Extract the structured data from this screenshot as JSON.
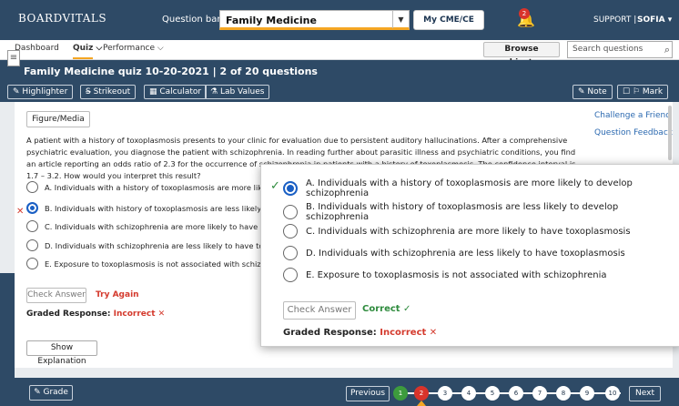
{
  "header": {
    "logo": "BOARDVITALS",
    "question_bank_label": "Question bank:",
    "question_bank_value": "Family Medicine",
    "my_cme": "My CME/CE",
    "notification_count": "2",
    "support": "SUPPORT |",
    "user": "SOFIA ▾"
  },
  "nav": {
    "dashboard": "Dashboard",
    "quiz": "Quiz",
    "performance": "Performance",
    "browse_subjects": "Browse subjects ▾",
    "search_placeholder": "Search questions"
  },
  "quiz": {
    "title": "Family Medicine quiz 10-20-2021 |  2 of 20  questions"
  },
  "toolbar": {
    "highlighter": "Highlighter",
    "strikeout": "Strikeout",
    "calculator": "Calculator",
    "lab_values": "Lab Values",
    "note": "Note",
    "mark": "Mark"
  },
  "question": {
    "figure_media": "Figure/Media",
    "stem": "A patient with a history of toxoplasmosis presents to your clinic for evaluation due to persistent auditory hallucinations. After a comprehensive psychiatric evaluation, you diagnose the patient with schizophrenia. In reading further about parasitic illness and psychiatric conditions, you find an article reporting an odds ratio of 2.3 for the occurrence of schizophrenia in patients with a history of toxoplasmosis. The confidence interval is 1.7 – 3.2. How would you interpret this result?",
    "options": [
      "A. Individuals with a history of toxoplasmosis are more likely to d",
      "B. Individuals with history of toxoplasmosis are less likely to dev",
      "C. Individuals with schizophrenia are more likely to have toxoplas",
      "D. Individuals with schizophrenia are less likely to have toxoplas",
      "E. Exposure to toxoplasmosis is not associated with schizophren"
    ],
    "selected_index": 1,
    "check_answer": "Check Answer",
    "try_again": "Try Again",
    "graded_label": "Graded Response:",
    "graded_value": "Incorrect ✕",
    "show_explanation": "Show Explanation"
  },
  "side_links": {
    "challenge": "Challenge a Friend",
    "feedback": "Question Feedback"
  },
  "zoom": {
    "options": [
      "A. Individuals with a history of toxoplasmosis are more likely to develop schizophrenia",
      "B. Individuals with history of toxoplasmosis are less likely to develop schizophrenia",
      "C. Individuals with schizophrenia are more likely to have toxoplasmosis",
      "D. Individuals with schizophrenia are less likely to have toxoplasmosis",
      "E. Exposure to toxoplasmosis is not associated with schizophrenia"
    ],
    "selected_index": 0,
    "check_answer": "Check Answer",
    "correct": "Correct ✓",
    "graded_label": "Graded Response:",
    "graded_value": "Incorrect ✕"
  },
  "footer": {
    "grade": "Grade",
    "previous": "Previous",
    "next": "Next",
    "pages": [
      "1",
      "2",
      "3",
      "4",
      "5",
      "6",
      "7",
      "8",
      "9",
      "10"
    ],
    "current_page": "2"
  },
  "colors": {
    "header_bg": "#2e4a66",
    "accent": "#f5a623",
    "incorrect": "#d43a2d",
    "correct": "#2e8b3d",
    "selected": "#1a5fc4"
  }
}
